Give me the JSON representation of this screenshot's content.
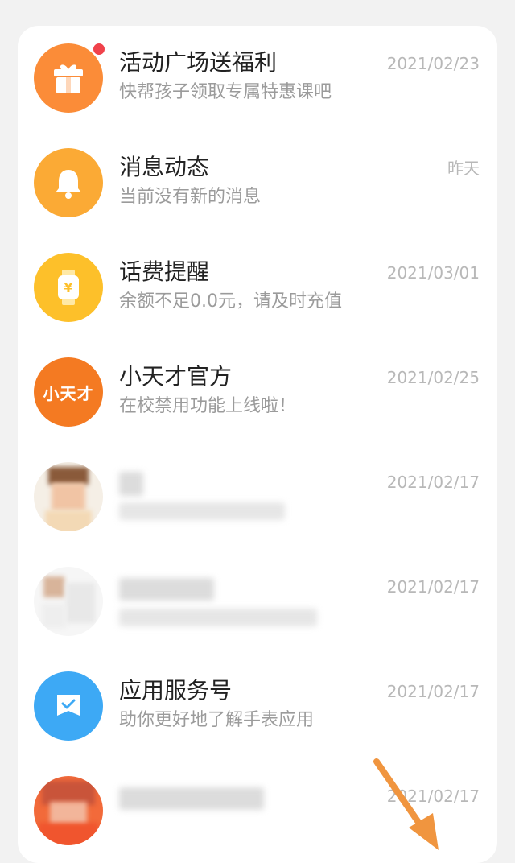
{
  "messages": [
    {
      "title": "活动广场送福利",
      "subtitle": "快帮孩子领取专属特惠课吧",
      "date": "2021/02/23",
      "icon": "gift-icon",
      "color": "#fb8c38",
      "unread": true
    },
    {
      "title": "消息动态",
      "subtitle": "当前没有新的消息",
      "date": "昨天",
      "icon": "bell-icon",
      "color": "#fbaa35"
    },
    {
      "title": "话费提醒",
      "subtitle": "余额不足0.0元，请及时充值",
      "date": "2021/03/01",
      "icon": "watch-yuan-icon",
      "color": "#fdc02a"
    },
    {
      "title": "小天才官方",
      "subtitle": "在校禁用功能上线啦！",
      "date": "2021/02/25",
      "icon": "xiaotiancai-logo",
      "color": "#f47a22",
      "logo_text": "小天才"
    },
    {
      "title": "",
      "subtitle": "",
      "date": "2021/02/17",
      "icon": "blurred-avatar"
    },
    {
      "title": "",
      "subtitle": "",
      "date": "2021/02/17",
      "icon": "blurred-avatar"
    },
    {
      "title": "应用服务号",
      "subtitle": "助你更好地了解手表应用",
      "date": "2021/02/17",
      "icon": "message-check-icon",
      "color": "#3da9f5"
    },
    {
      "title": "",
      "subtitle": "",
      "date": "2021/02/17",
      "icon": "blurred-avatar"
    }
  ]
}
